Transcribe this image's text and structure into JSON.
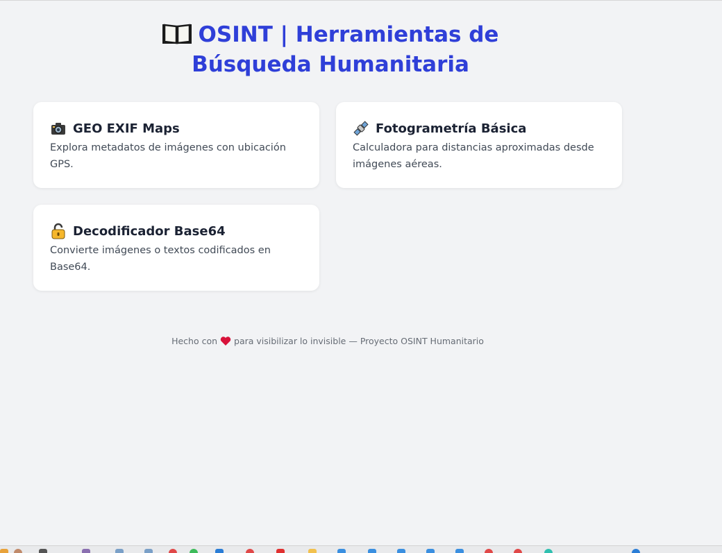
{
  "header": {
    "title": "OSINT | Herramientas de Búsqueda Humanitaria",
    "icon": "open-book-icon"
  },
  "tools": [
    {
      "icon": "camera-icon",
      "title": "GEO EXIF Maps",
      "description": "Explora metadatos de imágenes con ubicación GPS."
    },
    {
      "icon": "satellite-icon",
      "title": "Fotogrametría Básica",
      "description": "Calculadora para distancias aproximadas desde imágenes aéreas."
    },
    {
      "icon": "lock-icon",
      "title": "Decodificador Base64",
      "description": "Convierte imágenes o textos codificados en Base64."
    }
  ],
  "footer": {
    "before": "Hecho con",
    "icon": "heart-icon",
    "after": "para visibilizar lo invisible — Proyecto OSINT Humanitario"
  },
  "colors": {
    "accent": "#2f3fd8",
    "background": "#f2f3f5",
    "card": "#ffffff"
  }
}
